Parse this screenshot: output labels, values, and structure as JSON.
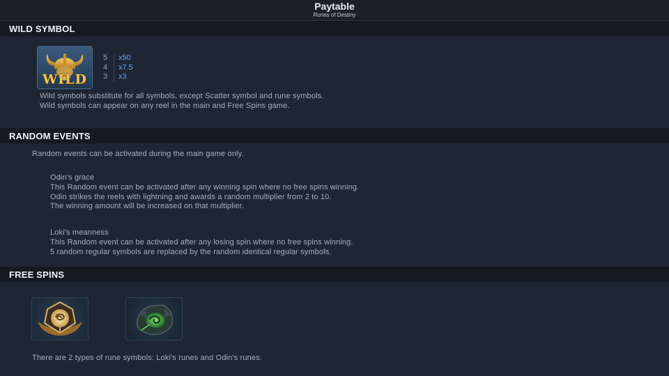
{
  "header": {
    "title": "Paytable",
    "subtitle": "Runes of Destiny"
  },
  "wild": {
    "heading": "WILD SYMBOL",
    "icon_text": "WILD",
    "payouts": [
      {
        "count": "5",
        "mult": "x50"
      },
      {
        "count": "4",
        "mult": "x7.5"
      },
      {
        "count": "3",
        "mult": "x3"
      }
    ],
    "desc1": "Wild symbols substitute for all symbols, except Scatter symbol and rune symbols.",
    "desc2": "Wild symbols can appear on any reel in the main and Free Spins game."
  },
  "random": {
    "heading": "RANDOM EVENTS",
    "intro": "Random events can be activated during the main game only.",
    "odin": {
      "title": "Odin's grace",
      "line1": "This Random event can be activated after any winning spin where no free spins winning.",
      "line2": "Odin strikes the reels with lightning and awards a random multiplier from 2 to 10.",
      "line3": "The winning amount will be increased on that multiplier."
    },
    "loki": {
      "title": "Loki's meanness",
      "line1": "This Random event can be activated after any losing spin where no free spins winning.",
      "line2": "5 random regular symbols are replaced by the random identical regular symbols."
    }
  },
  "free": {
    "heading": "FREE SPINS",
    "icons": [
      "odin-rune-icon",
      "loki-rune-icon"
    ],
    "desc": "There are 2 types of rune symbols: Loki's runes and Odin's runes."
  },
  "colors": {
    "background": "#1f2633",
    "header_band": "#141922",
    "multiplier": "#5aa9ff",
    "gold": "#d8a93a",
    "loki_green": "#4fd44a"
  }
}
